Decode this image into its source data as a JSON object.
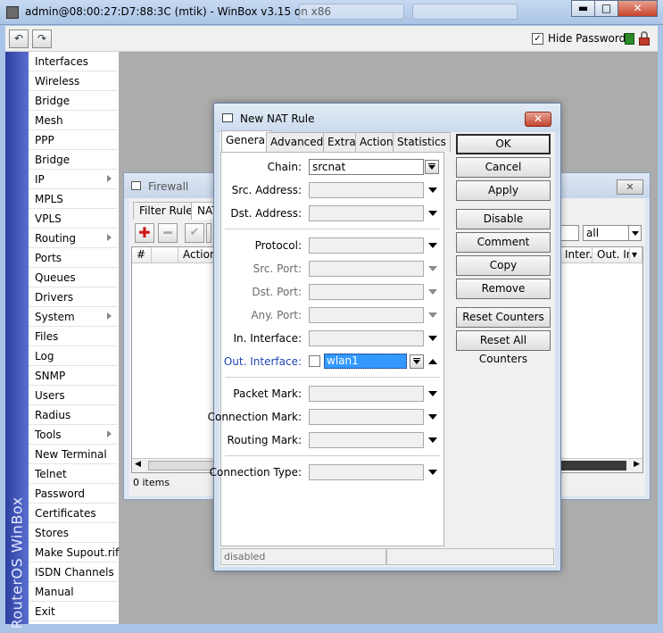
{
  "window": {
    "title": "admin@08:00:27:D7:88:3C (mtik) - WinBox v3.15 on x86",
    "buttons": {
      "minimize": "▬",
      "maximize": "□",
      "close": "✕"
    }
  },
  "toolbar": {
    "hide_passwords_label": "Hide Passwords",
    "hide_passwords_checked": "✓",
    "undo_glyph": "↶",
    "redo_glyph": "↷"
  },
  "sidebar": {
    "brand": "RouterOS WinBox",
    "items": [
      {
        "label": "Interfaces",
        "submenu": false
      },
      {
        "label": "Wireless",
        "submenu": false
      },
      {
        "label": "Bridge",
        "submenu": false
      },
      {
        "label": "Mesh",
        "submenu": false
      },
      {
        "label": "PPP",
        "submenu": false
      },
      {
        "label": "Bridge",
        "submenu": false
      },
      {
        "label": "IP",
        "submenu": true
      },
      {
        "label": "MPLS",
        "submenu": false
      },
      {
        "label": "VPLS",
        "submenu": false
      },
      {
        "label": "Routing",
        "submenu": true
      },
      {
        "label": "Ports",
        "submenu": false
      },
      {
        "label": "Queues",
        "submenu": false
      },
      {
        "label": "Drivers",
        "submenu": false
      },
      {
        "label": "System",
        "submenu": true
      },
      {
        "label": "Files",
        "submenu": false
      },
      {
        "label": "Log",
        "submenu": false
      },
      {
        "label": "SNMP",
        "submenu": false
      },
      {
        "label": "Users",
        "submenu": false
      },
      {
        "label": "Radius",
        "submenu": false
      },
      {
        "label": "Tools",
        "submenu": true
      },
      {
        "label": "New Terminal",
        "submenu": false
      },
      {
        "label": "Telnet",
        "submenu": false
      },
      {
        "label": "Password",
        "submenu": false
      },
      {
        "label": "Certificates",
        "submenu": false
      },
      {
        "label": "Stores",
        "submenu": false
      },
      {
        "label": "Make Supout.rif",
        "submenu": false
      },
      {
        "label": "ISDN Channels",
        "submenu": false
      },
      {
        "label": "Manual",
        "submenu": false
      },
      {
        "label": "Exit",
        "submenu": false
      }
    ]
  },
  "firewall": {
    "title": "Firewall",
    "close_glyph": "✕",
    "tabs": [
      "Filter Rules",
      "NAT"
    ],
    "add_glyph": "✚",
    "remove_glyph": "━",
    "enable_glyph": "✔",
    "filter_select": "all",
    "columns": [
      "#",
      "Action",
      "Inter...",
      "Out. Int."
    ],
    "status": "0 items",
    "scroll_left": "◀",
    "scroll_right": "▶"
  },
  "nat": {
    "title": "New NAT Rule",
    "close_glyph": "✕",
    "tabs": [
      "General",
      "Advanced",
      "Extra",
      "Action",
      "Statistics"
    ],
    "fields": {
      "chain": {
        "label": "Chain:",
        "value": "srcnat"
      },
      "src_address": {
        "label": "Src. Address:"
      },
      "dst_address": {
        "label": "Dst. Address:"
      },
      "protocol": {
        "label": "Protocol:"
      },
      "src_port": {
        "label": "Src. Port:"
      },
      "dst_port": {
        "label": "Dst. Port:"
      },
      "any_port": {
        "label": "Any. Port:"
      },
      "in_interface": {
        "label": "In. Interface:"
      },
      "out_interface": {
        "label": "Out. Interface:",
        "value": "wlan1"
      },
      "packet_mark": {
        "label": "Packet Mark:"
      },
      "connection_mark": {
        "label": "Connection Mark:"
      },
      "routing_mark": {
        "label": "Routing Mark:"
      },
      "connection_type": {
        "label": "Connection Type:"
      }
    },
    "buttons": [
      "OK",
      "Cancel",
      "Apply",
      "Disable",
      "Comment",
      "Copy",
      "Remove",
      "Reset Counters",
      "Reset All Counters"
    ],
    "status": "disabled"
  }
}
